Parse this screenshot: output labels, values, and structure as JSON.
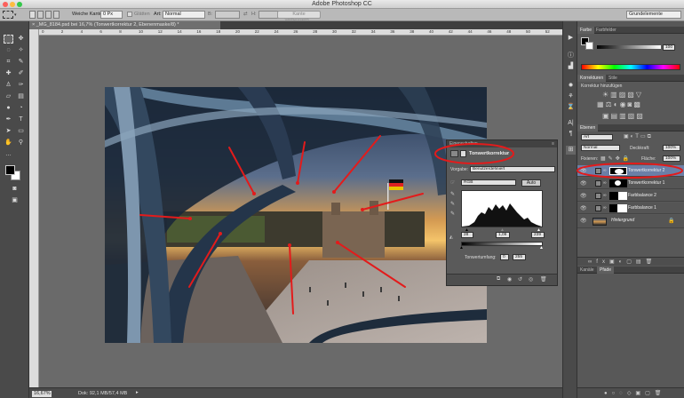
{
  "app": {
    "title": "Adobe Photoshop CC",
    "workspace": "Grundelemente"
  },
  "options_bar": {
    "weiche_kante_label": "Weiche Kante:",
    "weiche_kante_value": "0 Px",
    "glaetten_label": "Glätten",
    "art_label": "Art:",
    "art_value": "Normal",
    "b_label": "B:",
    "h_label": "H:",
    "kante_button": "Kante verbessern..."
  },
  "document": {
    "tab_title": "_MG_8184.psd bei 16,7% (Tonwertkorrektur 2, Ebenenmaske/8) *",
    "zoom": "16,67%",
    "doc_info": "Dok: 92,1 MB/57,4 MB",
    "ruler_ticks": [
      "0",
      "2",
      "4",
      "6",
      "8",
      "10",
      "12",
      "14",
      "16",
      "18",
      "20",
      "22",
      "24",
      "26",
      "28",
      "30",
      "32",
      "34",
      "36",
      "38",
      "40",
      "42",
      "44",
      "46",
      "48",
      "50",
      "52",
      "54"
    ]
  },
  "properties": {
    "tab": "Eigenschaften",
    "title": "Tonwertkorrektur",
    "preset_label": "Vorgabe:",
    "preset_value": "Benutzerdefiniert",
    "channel": "RGB",
    "auto_button": "Auto",
    "input_black": "28",
    "input_gamma": "1,09",
    "input_white": "239",
    "output_label": "Tonwertumfang:",
    "output_black": "0",
    "output_white": "255"
  },
  "color_panel": {
    "tabs": [
      "Farbe",
      "Farbfelder"
    ],
    "value": "100"
  },
  "adjustments_panel": {
    "tabs": [
      "Korrekturen",
      "Stile"
    ],
    "heading": "Korrektur hinzufügen"
  },
  "layers_panel": {
    "tab": "Ebenen",
    "filter": "Art",
    "blend_mode": "Normal",
    "opacity_label": "Deckkraft:",
    "opacity_value": "100%",
    "fix_label": "Fixieren:",
    "fill_label": "Fläche:",
    "fill_value": "100%",
    "layers": [
      {
        "name": "Tonwertkorrektur 2",
        "selected": true
      },
      {
        "name": "Tonwertkorrektur 1",
        "selected": false
      },
      {
        "name": "Farbbalance 2",
        "selected": false
      },
      {
        "name": "Farbbalance 1",
        "selected": false
      },
      {
        "name": "Hintergrund",
        "selected": false
      }
    ]
  },
  "bottom_tabs": [
    "Kanäle",
    "Pfade"
  ],
  "colors": {
    "annotation_red": "#e31b1b",
    "panel_dark": "#424242",
    "selected_layer": "#6b7fa7"
  }
}
